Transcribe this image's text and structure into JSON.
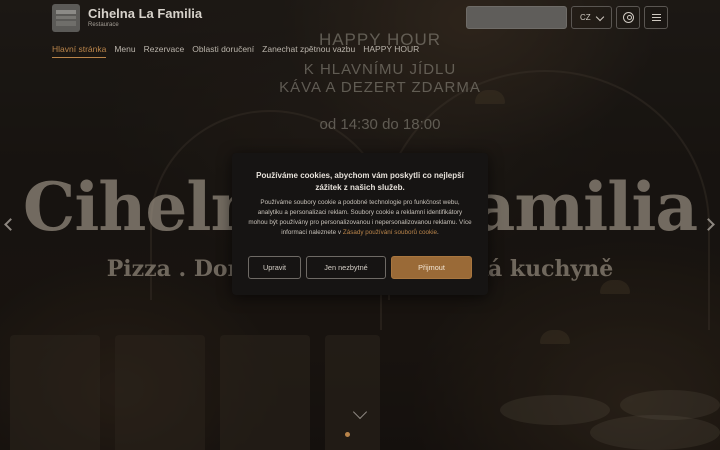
{
  "header": {
    "brand_name": "Cihelna La Familia",
    "brand_subtitle": "Restaurace",
    "language": "CZ"
  },
  "nav": {
    "items": [
      {
        "label": "Hlavní stránka",
        "active": true
      },
      {
        "label": "Menu"
      },
      {
        "label": "Rezervace"
      },
      {
        "label": "Oblasti doručení"
      },
      {
        "label": "Zanechat zpětnou vazbu"
      },
      {
        "label": "HAPPY HOUR"
      }
    ]
  },
  "banner": {
    "line1": "HAPPY HOUR",
    "line2": "K HLAVNÍMU JÍDLU",
    "line3": "KÁVA A DEZERT ZDARMA",
    "line4": "od 14:30 do 18:00"
  },
  "hero": {
    "title": "Cihelna La Familia",
    "subtitle": "Pizza . Domácí těstoviny . Česká kuchyně"
  },
  "cookie": {
    "title": "Používáme cookies, abychom vám poskytli co nejlepší zážitek z našich služeb.",
    "text": "Používáme soubory cookie a podobné technologie pro funkčnost webu, analytiku a personalizaci reklam. Soubory cookie a reklamní identifikátory mohou být používány pro personalizovanou i nepersonalizovanou reklamu. Více informací naleznete v",
    "link": "Zásady používání souborů cookie",
    "buttons": {
      "customize": "Upravit",
      "necessary": "Jen nezbytné",
      "accept": "Přijmout"
    }
  },
  "colors": {
    "accent": "#b9844a",
    "dialog_bg": "#161413"
  }
}
